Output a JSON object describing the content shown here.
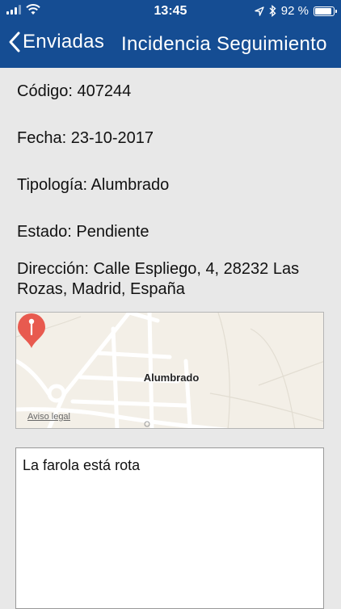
{
  "status_bar": {
    "time": "13:45",
    "battery_text": "92 %",
    "battery_level": 0.92,
    "icons": [
      "signal-icon",
      "wifi-icon",
      "location-arrow-icon",
      "bluetooth-icon",
      "battery-icon"
    ]
  },
  "nav": {
    "back_label": "Enviadas",
    "title": "Incidencia Seguimiento"
  },
  "incident": {
    "codigo": "Código: 407244",
    "fecha": "Fecha: 23-10-2017",
    "tipologia": "Tipología: Alumbrado",
    "estado": "Estado: Pendiente",
    "direccion": "Dirección: Calle Espliego, 4, 28232 Las Rozas, Madrid, España"
  },
  "map": {
    "marker_label": "Alumbrado",
    "legal_link": "Aviso legal",
    "marker_color": "#e85a4f"
  },
  "notes": {
    "text": "La farola está rota"
  },
  "colors": {
    "header": "#154d93",
    "background": "#e8e8e8"
  }
}
